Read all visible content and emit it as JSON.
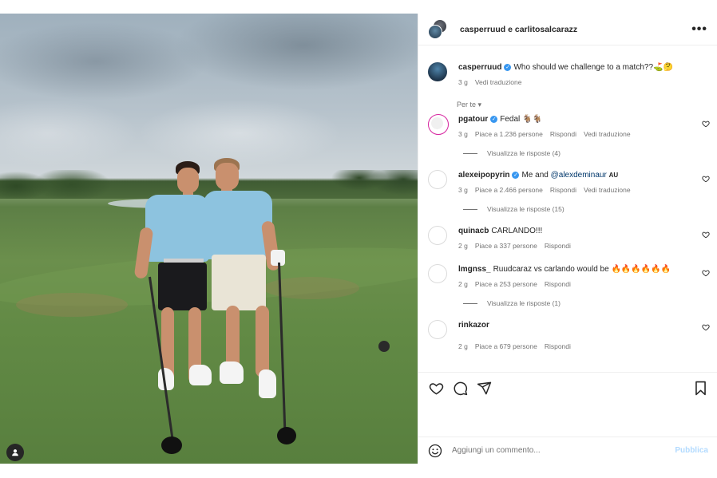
{
  "post": {
    "header_title": "casperruud e carlitosalcarazz",
    "more_label": "•••"
  },
  "caption": {
    "username": "casperruud",
    "text": "Who should we challenge to a match??⛳🤔",
    "time": "3 g",
    "translate": "Vedi traduzione"
  },
  "sort_label": "Per te ▾",
  "comments": [
    {
      "username": "pgatour",
      "verified": true,
      "text": "Fedal 🐐🐐",
      "time": "3 g",
      "likes": "Piace a 1.236 persone",
      "reply": "Rispondi",
      "translate": "Vedi traduzione",
      "replies": "Visualizza le risposte (4)"
    },
    {
      "username": "alexeipopyrin",
      "verified": true,
      "text": "Me and ",
      "mention": "@alexdeminaur",
      "suffix": "AU",
      "time": "3 g",
      "likes": "Piace a 2.466 persone",
      "reply": "Rispondi",
      "translate": "Vedi traduzione",
      "replies": "Visualizza le risposte (15)"
    },
    {
      "username": "quinacb",
      "verified": false,
      "text": "CARLANDO!!!",
      "time": "2 g",
      "likes": "Piace a 337 persone",
      "reply": "Rispondi"
    },
    {
      "username": "lmgnss_",
      "verified": false,
      "text": "Ruudcaraz vs carlando would be 🔥🔥🔥🔥🔥🔥",
      "time": "2 g",
      "likes": "Piace a 253 persone",
      "reply": "Rispondi",
      "replies": "Visualizza le risposte (1)"
    },
    {
      "username": "rinkazor",
      "verified": false,
      "text": "",
      "time": "2 g",
      "likes": "Piace a 679 persone",
      "reply": "Rispondi"
    }
  ],
  "composer": {
    "placeholder": "Aggiungi un commento...",
    "publish": "Pubblica"
  },
  "icons": {
    "like": "heart-icon",
    "comment": "comment-icon",
    "share": "send-icon",
    "save": "bookmark-icon",
    "emoji": "emoji-icon",
    "tagged_user": "user-icon"
  },
  "colors": {
    "verified": "#3897f0",
    "link": "#00376b",
    "publish_disabled": "#b3dbff",
    "secondary_text": "#737373"
  }
}
